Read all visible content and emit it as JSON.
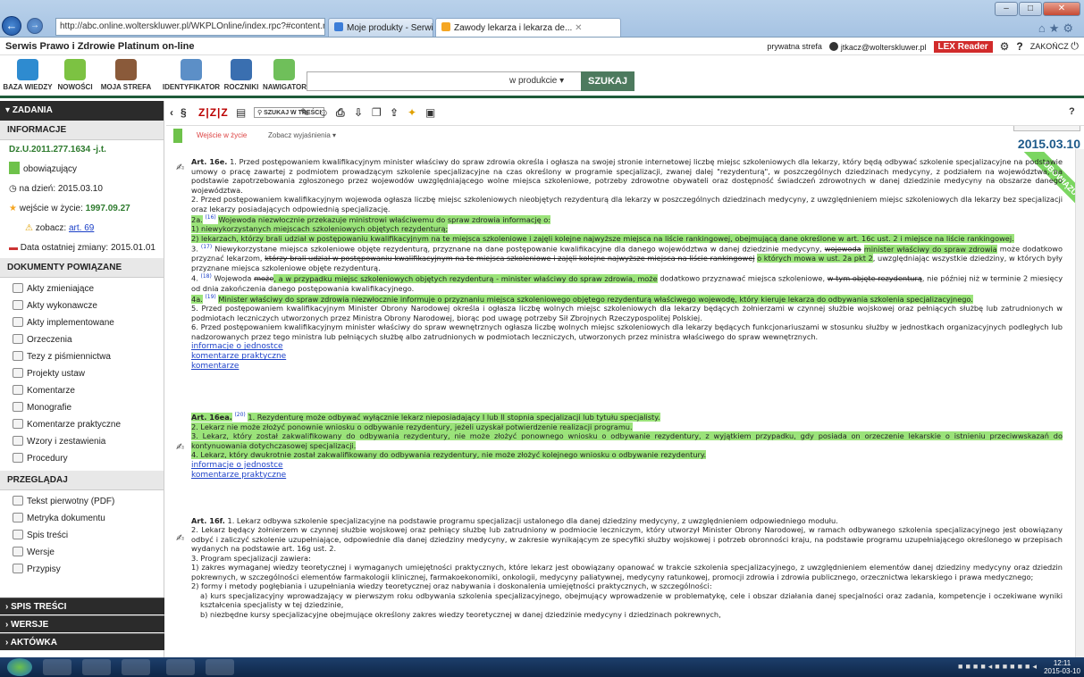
{
  "browser": {
    "url": "http://abc.online.wolterskluwer.pl/WKPLOnline/index.rpc?#content.rpc--",
    "tabs": [
      "Moje produkty - Serwis logow...",
      "Zawody lekarza i lekarza de..."
    ]
  },
  "app": {
    "title": "Serwis Prawo i Zdrowie Platinum on-line",
    "private_zone": "prywatna strefa",
    "user": "jtkacz@wolterskluwer.pl",
    "lex_reader": "LEX Reader",
    "logout": "ZAKOŃCZ"
  },
  "toolbar": {
    "tools": [
      "BAZA WIEDZY",
      "NOWOŚCI",
      "MOJA STREFA",
      "IDENTYFIKATOR",
      "ROCZNIKI",
      "NAWIGATOR"
    ],
    "search_scope": "w produkcie",
    "search_button": "SZUKAJ",
    "date_button": "STAN NA DZIEŃ",
    "date_value": "2015.03.10"
  },
  "sidebar": {
    "header": "ZADANIA",
    "info_section": "INFORMACJE",
    "doc_id": "Dz.U.2011.277.1634 -j.t.",
    "status": "obowiązujący",
    "as_of": "na dzień: 2015.03.10",
    "effective_label": "wejście w życie:",
    "effective_date": "1997.09.27",
    "see_label": "zobacz:",
    "see_link": "art. 69",
    "last_change": "Data ostatniej zmiany: 2015.01.01",
    "related_section": "DOKUMENTY POWIĄZANE",
    "related": [
      "Akty zmieniające",
      "Akty wykonawcze",
      "Akty implementowane",
      "Orzeczenia",
      "Tezy z piśmiennictwa",
      "Projekty ustaw",
      "Komentarze",
      "Monografie",
      "Komentarze praktyczne",
      "Wzory i zestawienia",
      "Procedury"
    ],
    "browse_section": "PRZEGLĄDAJ",
    "browse": [
      "Tekst pierwotny (PDF)",
      "Metryka dokumentu",
      "Spis treści",
      "Wersje",
      "Przypisy"
    ],
    "bottom": [
      "SPIS TREŚCI",
      "WERSJE",
      "AKTÓWKA"
    ]
  },
  "doc_toolbar": {
    "search_in_text": "SZUKAJ W TREŚCI",
    "tab_entry": "Wejście w życie",
    "tab_explain": "Zobacz wyjaśnienia"
  },
  "ribbon": "OBOWIĄZUJĄCY",
  "content": {
    "a16e_title": "Art. 16e.",
    "a16e_1": "1. Przed postępowaniem kwalifikacyjnym minister właściwy do spraw zdrowia określa i ogłasza na swojej stronie internetowej liczbę miejsc szkoleniowych dla lekarzy, który będą odbywać szkolenie specjalizacyjne na podstawie umowy o pracę zawartej z podmiotem prowadzącym szkolenie specjalizacyjne na czas określony w programie specjalizacji, zwanej dalej \"rezydenturą\", w poszczególnych dziedzinach medycyny, z podziałem na województwa, na podstawie zapotrzebowania zgłoszonego przez wojewodów uwzględniającego wolne miejsca szkoleniowe, potrzeby zdrowotne obywateli oraz dostępność świadczeń zdrowotnych w danej dziedzinie medycyny na obszarze danego województwa.",
    "a16e_2": "2. Przed postępowaniem kwalifikacyjnym wojewoda ogłasza liczbę miejsc szkoleniowych nieobjętych rezydenturą dla lekarzy w poszczególnych dziedzinach medycyny, z uwzględnieniem miejsc szkoleniowych dla lekarzy bez specjalizacji oraz lekarzy posiadających odpowiednią specjalizację.",
    "a16e_2a_num": "2a.",
    "a16e_2a_sup": "(16)",
    "a16e_2a": "Wojewoda niezwłocznie przekazuje ministrowi właściwemu do spraw zdrowia informację o:",
    "a16e_2a_1": "1) niewykorzystanych miejscach szkoleniowych objętych rezydenturą;",
    "a16e_2a_2": "2) lekarzach, którzy brali udział w postępowaniu kwalifikacyjnym na te miejsca szkoleniowe i zajęli kolejne najwyższe miejsca na liście rankingowej, obejmującą dane określone w art. 16c ust. 2 i miejsce na liście rankingowej.",
    "a16e_3_num": "3.",
    "a16e_3_sup": "(17)",
    "a16e_3a": "Niewykorzystane miejsca szkoleniowe objęte rezydenturą, przyznane na dane postępowanie kwalifikacyjne dla danego województwa w danej dziedzinie medycyny,",
    "a16e_3_strike1": "wojewoda",
    "a16e_3_hl1": "minister właściwy do spraw zdrowia",
    "a16e_3b": "może dodatkowo przyznać lekarzom,",
    "a16e_3_strike2": "którzy brali udział w postępowaniu kwalifikacyjnym na te miejsca szkoleniowe i zajęli kolejne najwyższe miejsca na liście rankingowej",
    "a16e_3_hl2": "o których mowa w ust. 2a pkt 2",
    "a16e_3c": ", uwzględniając wszystkie dziedziny, w których były przyznane miejsca szkoleniowe objęte rezydenturą.",
    "a16e_4_num": "4.",
    "a16e_4_sup": "(18)",
    "a16e_4a": "Wojewoda",
    "a16e_4_strike1": "może",
    "a16e_4_hl1": ", a w przypadku miejsc szkoleniowych objętych rezydenturą - minister właściwy do spraw zdrowia, może",
    "a16e_4b": "dodatkowo przyznawać miejsca szkoleniowe,",
    "a16e_4_strike2": "w tym objęte rezydenturą",
    "a16e_4c": ", nie później niż w terminie 2 miesięcy od dnia zakończenia danego postępowania kwalifikacyjnego.",
    "a16e_4a_num": "4a.",
    "a16e_4a_sup": "(19)",
    "a16e_4a_text": "Minister właściwy do spraw zdrowia niezwłocznie informuje o przyznaniu miejsca szkoleniowego objętego rezydenturą właściwego wojewodę, który kieruje lekarza do odbywania szkolenia specjalizacyjnego.",
    "a16e_5": "5. Przed postępowaniem kwalifikacyjnym Minister Obrony Narodowej określa i ogłasza liczbę wolnych miejsc szkoleniowych dla lekarzy będących żołnierzami w czynnej służbie wojskowej oraz pełniących służbę lub zatrudnionych w podmiotach leczniczych utworzonych przez Ministra Obrony Narodowej, biorąc pod uwagę potrzeby Sił Zbrojnych Rzeczypospolitej Polskiej.",
    "a16e_6": "6. Przed postępowaniem kwalifikacyjnym minister właściwy do spraw wewnętrznych ogłasza liczbę wolnych miejsc szkoleniowych dla lekarzy będących funkcjonariuszami w stosunku służby w jednostkach organizacyjnych podległych lub nadzorowanych przez tego ministra lub pełniących służbę albo zatrudnionych w podmiotach leczniczych, utworzonych przez ministra właściwego do spraw wewnętrznych.",
    "link_info": "informacje o jednostce",
    "link_comments_practical": "komentarze praktyczne",
    "link_comments": "komentarze",
    "a16ea_title": "Art. 16ea.",
    "a16ea_sup": "(20)",
    "a16ea_1": "1. Rezydenturę może odbywać wyłącznie lekarz nieposiadający I lub II stopnia specjalizacji lub tytułu specjalisty.",
    "a16ea_2": "2. Lekarz nie może złożyć ponownie wniosku o odbywanie rezydentury, jeżeli uzyskał potwierdzenie realizacji programu.",
    "a16ea_3": "3. Lekarz, który został zakwalifikowany do odbywania rezydentury, nie może złożyć ponownego wniosku o odbywanie rezydentury, z wyjątkiem przypadku, gdy posiada on orzeczenie lekarskie o istnieniu przeciwwskazań do kontynuowania dotychczasowej specjalizacji.",
    "a16ea_4": "4. Lekarz, który dwukrotnie został zakwalifikowany do odbywania rezydentury, nie może złożyć kolejnego wniosku o odbywanie rezydentury.",
    "a16f_title": "Art. 16f.",
    "a16f_1": "1. Lekarz odbywa szkolenie specjalizacyjne na podstawie programu specjalizacji ustalonego dla danej dziedziny medycyny, z uwzględnieniem odpowiedniego modułu.",
    "a16f_2": "2. Lekarz będący żołnierzem w czynnej służbie wojskowej oraz pełniący służbę lub zatrudniony w podmiocie leczniczym, który utworzył Minister Obrony Narodowej, w ramach odbywanego szkolenia specjalizacyjnego jest obowiązany odbyć i zaliczyć szkolenie uzupełniające, odpowiednie dla danej dziedziny medycyny, w zakresie wynikającym ze specyfiki służby wojskowej i potrzeb obronności kraju, na podstawie programu uzupełniającego określonego w przepisach wydanych na podstawie art. 16g ust. 2.",
    "a16f_3": "3. Program specjalizacji zawiera:",
    "a16f_3_1": "1) zakres wymaganej wiedzy teoretycznej i wymaganych umiejętności praktycznych, które lekarz jest obowiązany opanować w trakcie szkolenia specjalizacyjnego, z uwzględnieniem elementów danej dziedziny medycyny oraz dziedzin pokrewnych, w szczególności elementów farmakologii klinicznej, farmakoekonomiki, onkologii, medycyny paliatywnej, medycyny ratunkowej, promocji zdrowia i zdrowia publicznego, orzecznictwa lekarskiego i prawa medycznego;",
    "a16f_3_2": "2) formy i metody pogłębiania i uzupełniania wiedzy teoretycznej oraz nabywania i doskonalenia umiejętności praktycznych, w szczególności:",
    "a16f_3_2a": "a) kurs specjalizacyjny wprowadzający w pierwszym roku odbywania szkolenia specjalizacyjnego, obejmujący wprowadzenie w problematykę, cele i obszar działania danej specjalności oraz zadania, kompetencje i oczekiwane wyniki kształcenia specjalisty w tej dziedzinie,",
    "a16f_3_2b": "b) niezbędne kursy specjalizacyjne obejmujące określony zakres wiedzy teoretycznej w danej dziedzinie medycyny i dziedzinach pokrewnych,"
  },
  "taskbar": {
    "time": "12:11",
    "date": "2015-03-10"
  }
}
